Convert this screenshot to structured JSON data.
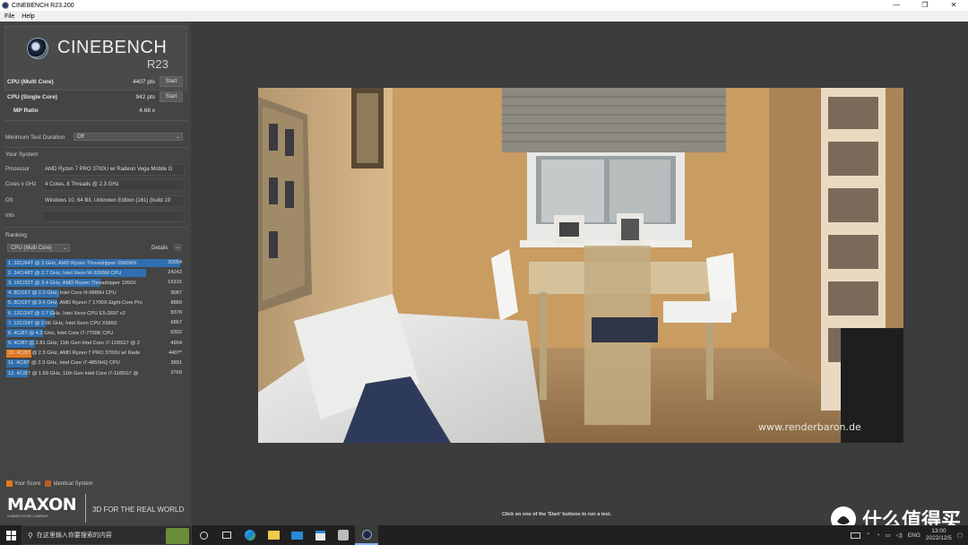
{
  "window": {
    "title": "CINEBENCH R23.200",
    "menu": [
      "File",
      "Help"
    ],
    "controls": [
      "—",
      "❐",
      "✕"
    ]
  },
  "logo": {
    "name": "CINEBENCH",
    "version": "R23"
  },
  "scores": [
    {
      "label": "CPU (Multi Core)",
      "value": "4407 pts",
      "button": "Start"
    },
    {
      "label": "CPU (Single Core)",
      "value": "942 pts",
      "button": "Start"
    },
    {
      "label": "MP Ratio",
      "value": "4.68 x"
    }
  ],
  "min_test": {
    "label": "Minimum Test Duration",
    "value": "Off"
  },
  "your_system": {
    "heading": "Your System",
    "rows": [
      {
        "key": "Processor",
        "value": "AMD Ryzen 7 PRO 3700U w/ Radeon Vega Mobile G"
      },
      {
        "key": "Cores x GHz",
        "value": "4 Cores, 8 Threads @ 2.3 GHz"
      },
      {
        "key": "OS",
        "value": "Windows 10, 64 Bit, Unknown Edition (161) (build 19"
      },
      {
        "key": "Info",
        "value": ""
      }
    ]
  },
  "ranking": {
    "heading": "Ranking",
    "dropdown": "CPU (Multi Core)",
    "details": "Details",
    "max_score": 30054,
    "rows": [
      {
        "text": "1. 32C/64T @ 3 GHz, AMD Ryzen Threadripper 2990WX",
        "score": "30054",
        "value": 30054,
        "mine": false
      },
      {
        "text": "2. 24C/48T @ 2.7 GHz, Intel Xeon W-3265M CPU",
        "score": "24243",
        "value": 24243,
        "mine": false
      },
      {
        "text": "3. 16C/32T @ 3.4 GHz, AMD Ryzen Threadripper 1950X",
        "score": "16315",
        "value": 16315,
        "mine": false
      },
      {
        "text": "4. 8C/16T @ 2.3 GHz, Intel Core i9-9880H CPU",
        "score": "9087",
        "value": 9087,
        "mine": false
      },
      {
        "text": "5. 8C/16T @ 3.4 GHz, AMD Ryzen 7 1700X Eight-Core Pro",
        "score": "8889",
        "value": 8889,
        "mine": false
      },
      {
        "text": "6. 12C/24T @ 2.7 GHz, Intel Xeon CPU E5-2697 v2",
        "score": "8378",
        "value": 8378,
        "mine": false
      },
      {
        "text": "7. 12C/24T @ 2.66 GHz, Intel Xeon CPU X5650",
        "score": "6867",
        "value": 6867,
        "mine": false
      },
      {
        "text": "8. 4C/8T @ 4.2 GHz, Intel Core i7-7700K CPU",
        "score": "6302",
        "value": 6302,
        "mine": false
      },
      {
        "text": "9. 4C/8T @ 2.81 GHz, 11th Gen Intel Core i7-1165G7 @ 2",
        "score": "4904",
        "value": 4904,
        "mine": false
      },
      {
        "text": "10. 4C/8T @ 2.3 GHz, AMD Ryzen 7 PRO 3700U w/ Rade",
        "score": "4407*",
        "value": 4407,
        "mine": true
      },
      {
        "text": "11. 4C/8T @ 2.3 GHz, Intel Core i7-4850HQ CPU",
        "score": "3891",
        "value": 3891,
        "mine": false
      },
      {
        "text": "12. 4C/8T @ 1.69 GHz, 11th Gen Intel Core i7-1165G7 @",
        "score": "3769",
        "value": 3769,
        "mine": false
      }
    ]
  },
  "legend": {
    "your_score": "Your Score",
    "identical": "Identical System",
    "your_color": "#e07a20",
    "identical_color": "#b5602a"
  },
  "brand": {
    "maxon": "MAXON",
    "maxon_sub": "A NEMETSCHEK COMPANY",
    "tagline": "3D FOR THE REAL WORLD"
  },
  "render": {
    "watermark": "www.renderbaron.de"
  },
  "status": "Click on one of the 'Start' buttons to run a test.",
  "taskbar": {
    "search_placeholder": "在这里输入你要搜索的内容",
    "tray": {
      "lang": "ENG",
      "time": "13:00",
      "date": "2022/12/5"
    }
  },
  "site_watermark": "什么值得买"
}
